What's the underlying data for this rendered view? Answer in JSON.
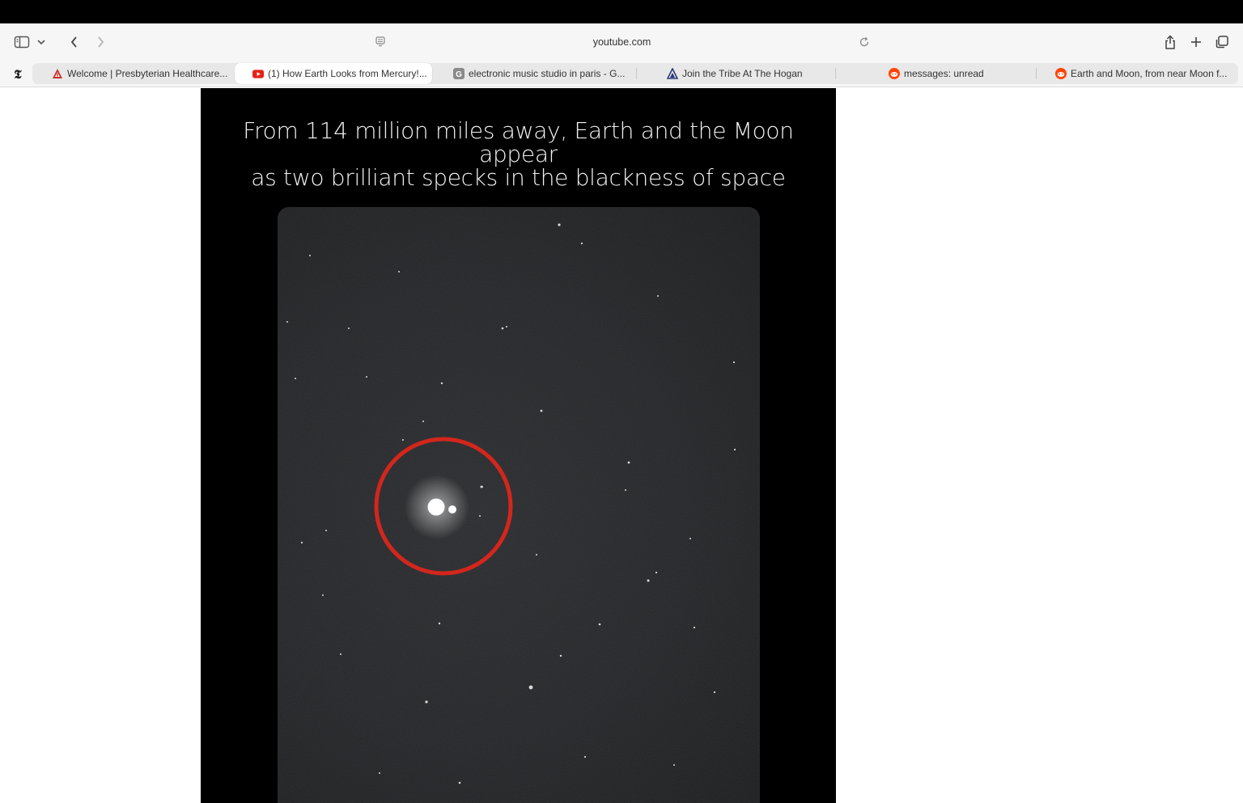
{
  "browser": {
    "url": "youtube.com",
    "pinned_tab": {
      "icon": "nytimes-icon",
      "label": "𝕿"
    },
    "tabs": [
      {
        "title": "Welcome | Presbyterian Healthcare...",
        "icon": "presbyterian-icon",
        "active": false
      },
      {
        "title": "(1) How Earth Looks from Mercury!...",
        "icon": "youtube-icon",
        "active": true
      },
      {
        "title": "electronic music studio in paris - G...",
        "icon": "google-g-icon",
        "active": false
      },
      {
        "title": "Join the Tribe At The Hogan",
        "icon": "hogan-icon",
        "active": false
      },
      {
        "title": "messages: unread",
        "icon": "reddit-icon",
        "active": false
      },
      {
        "title": "Earth and Moon, from near Moon f...",
        "icon": "reddit-icon",
        "active": false
      }
    ]
  },
  "video": {
    "caption_line1": "From 114 million miles away, Earth and the Moon appear",
    "caption_line2": "as two brilliant specks in the blackness of space",
    "highlight_color": "#d3261c"
  }
}
